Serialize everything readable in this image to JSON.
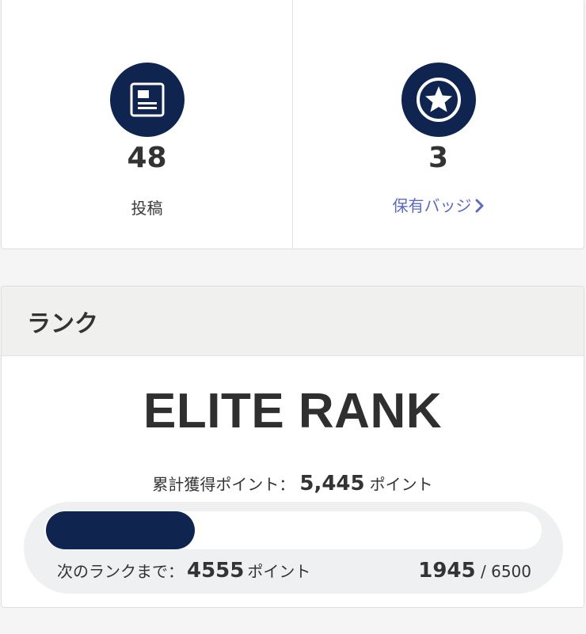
{
  "stats": {
    "posts": {
      "value": "48",
      "label": "投稿",
      "icon": "article-icon"
    },
    "badges": {
      "value": "3",
      "label": "保有バッジ",
      "icon": "star-badge-icon"
    }
  },
  "rank": {
    "section_title": "ランク",
    "name": "ELITE RANK",
    "total_label": "累計獲得ポイント：",
    "total_points": "5,445",
    "points_unit": "ポイント",
    "next_label": "次のランクまで：",
    "points_to_next": "4555",
    "progress_current": "1945",
    "progress_separator": "/",
    "progress_max": "6500",
    "progress_fraction": 0.299
  },
  "colors": {
    "accent": "#0f2550",
    "link": "#5c6bc0"
  }
}
